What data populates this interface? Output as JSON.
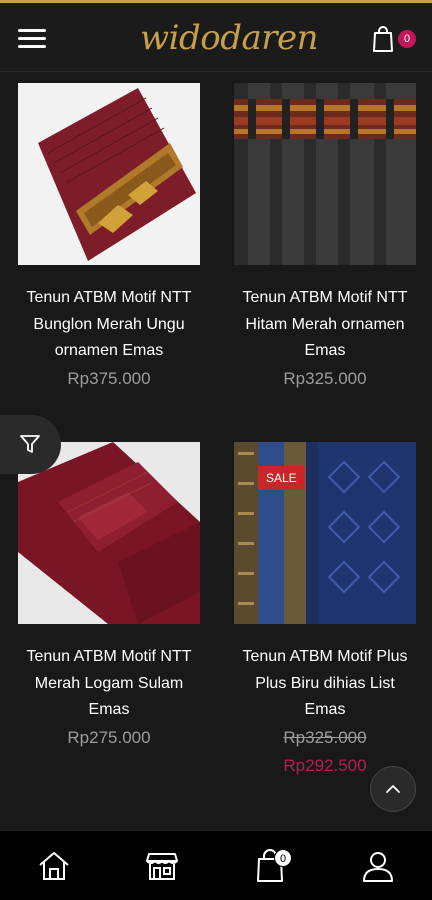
{
  "header": {
    "logo_text": "widodaren",
    "cart_count": "0"
  },
  "products": [
    {
      "name": "Tenun ATBM Motif NTT Bunglon Merah Ungu ornamen Emas",
      "price": "Rp375.000"
    },
    {
      "name": "Tenun ATBM Motif NTT Hitam Merah ornamen Emas",
      "price": "Rp325.000"
    },
    {
      "name": "Tenun ATBM Motif NTT Merah Logam Sulam Emas",
      "price": "Rp275.000"
    },
    {
      "name": "Tenun ATBM Motif Plus Plus Biru dihias List Emas",
      "price_old": "Rp325.000",
      "price_sale": "Rp292.500",
      "badge": "SALE"
    }
  ],
  "bottom_nav": {
    "items": [
      "home-icon",
      "shop-icon",
      "cart-icon",
      "account-icon"
    ],
    "cart_count": "0"
  },
  "colors": {
    "accent_gold": "#c9a04a",
    "sale_red": "#c62828",
    "sale_price": "#b51f52",
    "background": "#191919"
  }
}
